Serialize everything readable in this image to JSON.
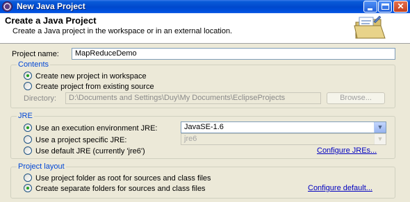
{
  "window": {
    "title": "New Java Project",
    "minimize_glyph": "",
    "close_glyph": "✕"
  },
  "banner": {
    "heading": "Create a Java Project",
    "description": "Create a Java project in the workspace or in an external location.",
    "icon": "new-java-project-wizard-folder"
  },
  "project_name": {
    "label": "Project name:",
    "value": "MapReduceDemo"
  },
  "contents": {
    "title": "Contents",
    "options": [
      {
        "label": "Create new project in workspace",
        "checked": true
      },
      {
        "label": "Create project from existing source",
        "checked": false
      }
    ],
    "directory_label": "Directory:",
    "directory_value": "D:\\Documents and Settings\\Duy\\My Documents\\EclipseProjects",
    "browse_label": "Browse..."
  },
  "jre": {
    "title": "JRE",
    "options": [
      {
        "label": "Use an execution environment JRE:",
        "checked": true
      },
      {
        "label": "Use a project specific JRE:",
        "checked": false
      },
      {
        "label": "Use default JRE (currently 'jre6')",
        "checked": false
      }
    ],
    "execution_env_value": "JavaSE-1.6",
    "project_jre_value": "jre6",
    "configure_link": "Configure JREs..."
  },
  "project_layout": {
    "title": "Project layout",
    "options": [
      {
        "label": "Use project folder as root for sources and class files",
        "checked": false
      },
      {
        "label": "Create separate folders for sources and class files",
        "checked": true
      }
    ],
    "configure_link": "Configure default..."
  },
  "colors": {
    "titlebar": "#0048cd",
    "group_title": "#0046d5",
    "link": "#0000c0",
    "dialog_bg": "#ece9d8"
  }
}
